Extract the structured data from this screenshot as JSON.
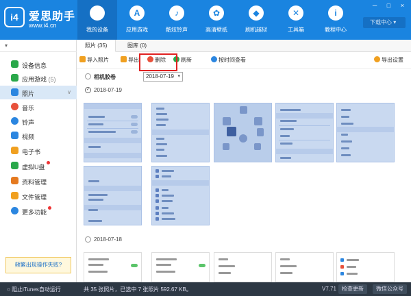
{
  "app": {
    "logo_mark": "i4",
    "logo_name": "爱思助手",
    "logo_url": "www.i4.cn",
    "window_controls": "─ □ ×",
    "download_center": "下载中心",
    "nav": [
      {
        "label": "我的设备",
        "icon": "apple-icon",
        "glyph": ""
      },
      {
        "label": "应用游戏",
        "icon": "appstore-icon",
        "glyph": "A"
      },
      {
        "label": "酷炫铃声",
        "icon": "bell-icon",
        "glyph": "♪"
      },
      {
        "label": "高清壁纸",
        "icon": "flower-icon",
        "glyph": "✿"
      },
      {
        "label": "刷机越狱",
        "icon": "box-icon",
        "glyph": "◆"
      },
      {
        "label": "工具箱",
        "icon": "tools-icon",
        "glyph": "✕"
      },
      {
        "label": "教程中心",
        "icon": "info-icon",
        "glyph": "i"
      }
    ]
  },
  "sidebar": {
    "device_select": "",
    "items": [
      {
        "label": "设备信息",
        "count": "",
        "icon": "info-icon",
        "color": "#2aa84a"
      },
      {
        "label": "应用游戏",
        "count": "(5)",
        "icon": "apps-icon",
        "color": "#2aa84a"
      },
      {
        "label": "照片",
        "count": "",
        "icon": "photo-icon",
        "color": "#2b86e0"
      },
      {
        "label": "音乐",
        "count": "",
        "icon": "music-icon",
        "color": "#e8513b"
      },
      {
        "label": "铃声",
        "count": "",
        "icon": "bell-icon",
        "color": "#2b86e0"
      },
      {
        "label": "视频",
        "count": "",
        "icon": "video-icon",
        "color": "#2b86e0"
      },
      {
        "label": "电子书",
        "count": "",
        "icon": "book-icon",
        "color": "#f0a020"
      },
      {
        "label": "虚拟U盘",
        "count": "",
        "icon": "usb-icon",
        "color": "#2aa84a"
      },
      {
        "label": "资料管理",
        "count": "",
        "icon": "contacts-icon",
        "color": "#e57a20"
      },
      {
        "label": "文件管理",
        "count": "",
        "icon": "folder-icon",
        "color": "#f0a020"
      },
      {
        "label": "更多功能",
        "count": "",
        "icon": "more-icon",
        "color": "#2b86e0"
      }
    ],
    "feedback": "频繁出现操作失败?"
  },
  "tabs": [
    {
      "label": "照片 (35)"
    },
    {
      "label": "图库 (0)"
    }
  ],
  "toolbar": {
    "import": "导入照片",
    "export": "导出",
    "delete": "删除",
    "refresh": "刷新",
    "by_time": "按时间查看",
    "export_settings": "导出设置"
  },
  "filter": {
    "album": "相机胶卷",
    "date": "2018-07-19"
  },
  "sections": [
    {
      "date": "2018-07-19"
    },
    {
      "date": "2018-07-18"
    }
  ],
  "status": {
    "itunes": "阻止iTunes自动运行",
    "summary": "共 35 张照片，已选中 7 张照片 592.67 KB。",
    "version": "V7.71",
    "update": "检查更新",
    "wechat": "微信公众号"
  },
  "colors": {
    "accent": "#1a84e0",
    "highlight": "#e02020",
    "selection": "#c9d9f0"
  }
}
